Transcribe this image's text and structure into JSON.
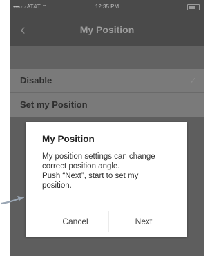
{
  "status_bar": {
    "carrier": "•••○○ AT&T ⌔",
    "time": "12:35 PM"
  },
  "nav": {
    "title": "My Position",
    "back_icon": "chevron-left-icon"
  },
  "list": {
    "items": [
      {
        "label": "Disable",
        "checked": true
      },
      {
        "label": "Set my Position",
        "checked": false
      }
    ],
    "check_glyph": "✓"
  },
  "dialog": {
    "title": "My Position",
    "message_lines": [
      "My position settings can change",
      "correct position angle.",
      "Push “Next”, start to set my",
      "position."
    ],
    "cancel_label": "Cancel",
    "next_label": "Next"
  },
  "colors": {
    "overlay": "#6c6c6c",
    "dialog_bg": "#ffffff",
    "arrow": "#9aa6b4"
  }
}
